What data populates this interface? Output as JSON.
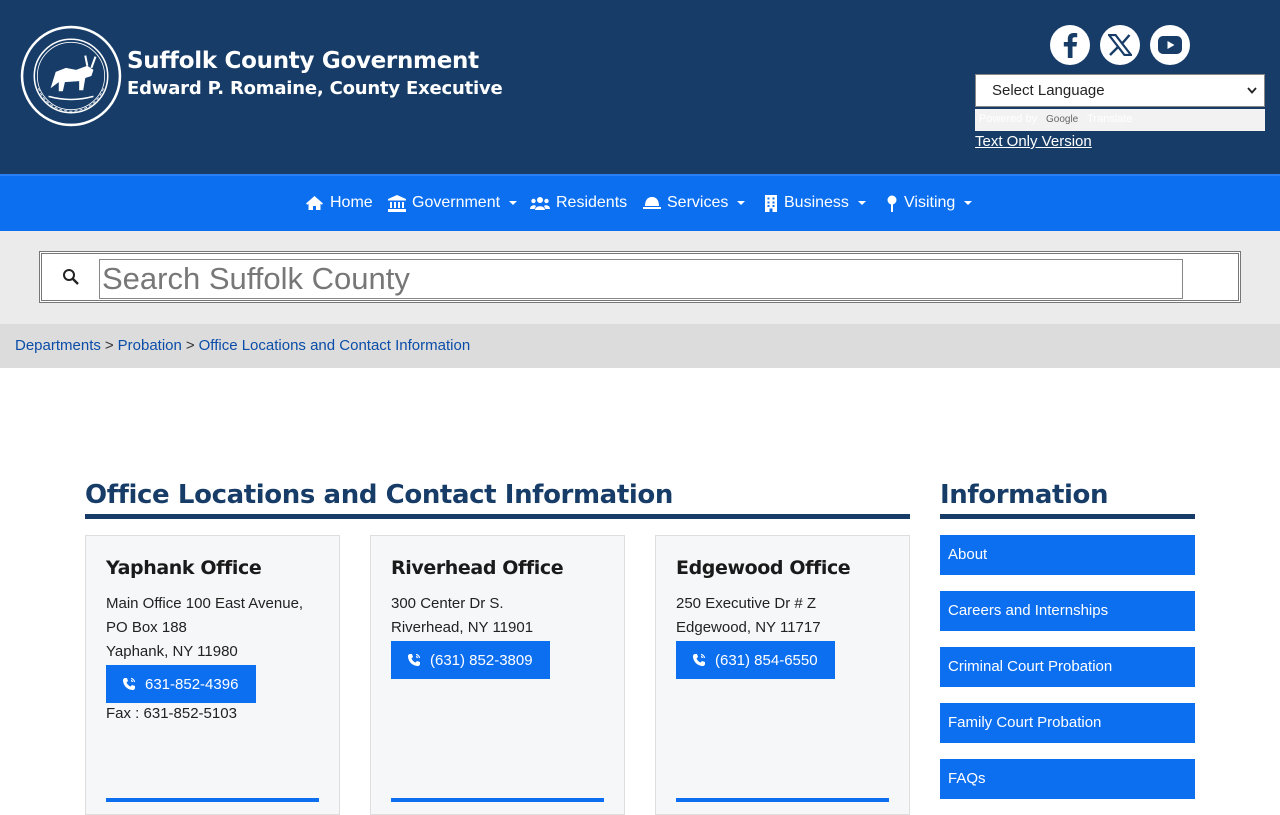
{
  "header": {
    "title": "Suffolk County Government",
    "subtitle": "Edward P. Romaine, County Executive",
    "seal_icon": "suffolk-county-seal",
    "social": [
      {
        "name": "facebook-icon"
      },
      {
        "name": "x-icon"
      },
      {
        "name": "youtube-icon"
      }
    ],
    "language_select": "Select Language",
    "powered_by": "Powered by",
    "google": "Google",
    "translate": "Translate",
    "text_only": "Text Only Version"
  },
  "nav": {
    "items": [
      {
        "label": "Home",
        "icon": "home-icon",
        "dropdown": false
      },
      {
        "label": "Government",
        "icon": "government-icon",
        "dropdown": true
      },
      {
        "label": "Residents",
        "icon": "users-icon",
        "dropdown": false
      },
      {
        "label": "Services",
        "icon": "bell-icon",
        "dropdown": true
      },
      {
        "label": "Business",
        "icon": "building-icon",
        "dropdown": true
      },
      {
        "label": "Visiting",
        "icon": "map-pin-icon",
        "dropdown": true
      }
    ]
  },
  "search": {
    "placeholder": "Search Suffolk County"
  },
  "breadcrumb": {
    "items": [
      "Departments",
      "Probation",
      "Office Locations and Contact Information"
    ],
    "separator": ">"
  },
  "main": {
    "title": "Office Locations and Contact Information",
    "offices": [
      {
        "name": "Yaphank Office",
        "lines": [
          "Main Office 100 East Avenue,",
          "PO Box 188",
          "Yaphank, NY 11980"
        ],
        "phone": "631-852-4396",
        "fax": "Fax : 631-852-5103"
      },
      {
        "name": "Riverhead Office",
        "lines": [
          "300 Center Dr S.",
          "Riverhead, NY 11901"
        ],
        "phone": "(631) 852-3809"
      },
      {
        "name": "Edgewood Office",
        "lines": [
          "250 Executive Dr # Z",
          "Edgewood, NY 11717"
        ],
        "phone": "(631) 854-6550"
      }
    ]
  },
  "sidebar": {
    "title": "Information",
    "links": [
      "About",
      "Careers and Internships",
      "Criminal Court Probation",
      "Family Court Probation",
      "FAQs"
    ]
  },
  "colors": {
    "header_bg": "#163c67",
    "nav_bg": "#0b6ff0",
    "accent": "#0b6ff0"
  }
}
